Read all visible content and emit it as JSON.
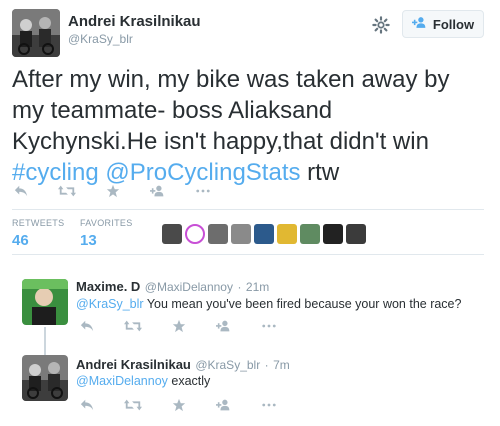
{
  "tweet": {
    "author": {
      "name": "Andrei Krasilnikau",
      "handle": "@KraSy_blr"
    },
    "follow_label": "Follow",
    "text_plain_1": "After my win, my bike was taken away by my teammate- boss Aliaksand Kychynski.He isn't happy,that didn't win ",
    "hashtag": "#cycling",
    "mention": "@ProCyclingStats",
    "text_plain_2": " rtw",
    "stats": {
      "retweets_label": "RETWEETS",
      "retweets": "46",
      "favorites_label": "FAVORITES",
      "favorites": "13"
    },
    "action_icons": [
      "reply-icon",
      "retweet-icon",
      "favorite-icon",
      "follow-user-icon",
      "more-icon"
    ]
  },
  "replies": [
    {
      "name": "Maxime. D",
      "handle": "@MaxiDelannoy",
      "time": "21m",
      "mention": "@KraSy_blr",
      "text": " You mean you've been fired because your won the race?"
    },
    {
      "name": "Andrei Krasilnikau",
      "handle": "@KraSy_blr",
      "time": "7m",
      "mention": "@MaxiDelannoy",
      "text": " exactly"
    }
  ],
  "colors": {
    "link": "#55acee",
    "muted": "#8899a6",
    "text": "#292f33",
    "divider": "#e1e8ed"
  }
}
